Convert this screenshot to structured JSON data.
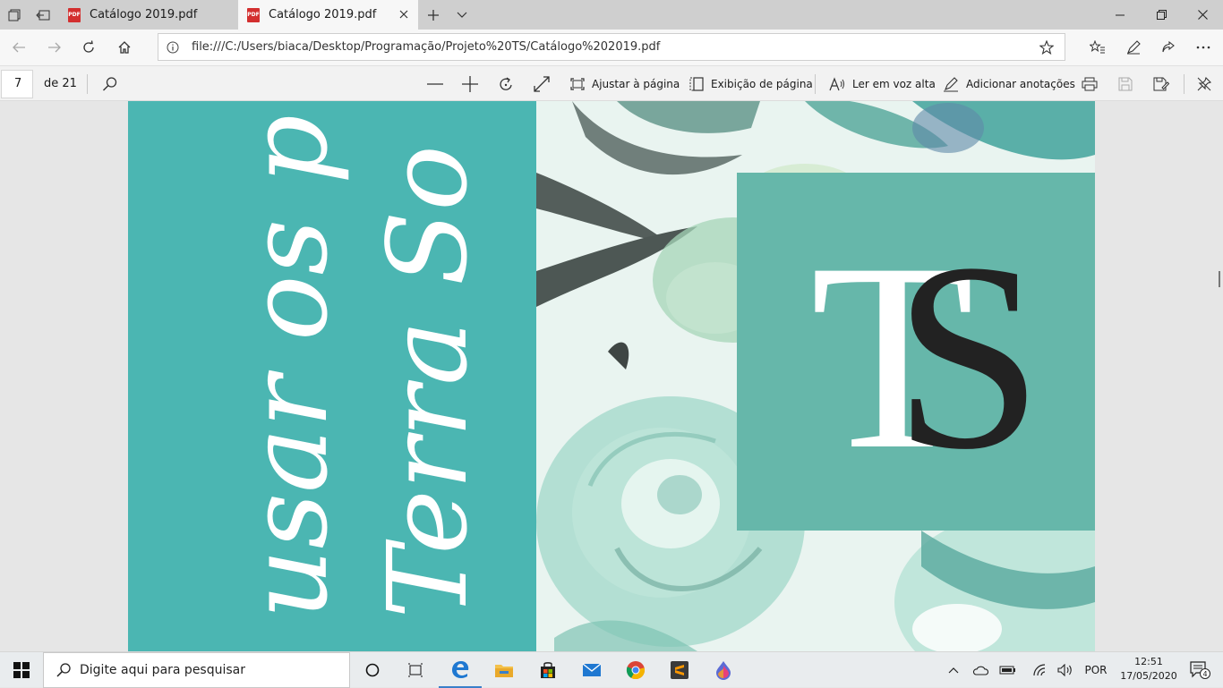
{
  "tabs": [
    {
      "label": "Catálogo 2019.pdf",
      "active": false
    },
    {
      "label": "Catálogo 2019.pdf",
      "active": true
    }
  ],
  "address": {
    "url": "file:///C:/Users/biaca/Desktop/Programação/Projeto%20TS/Catálogo%202019.pdf"
  },
  "pdf_toolbar": {
    "page_number": "7",
    "page_total": "de 21",
    "fit_page_label": "Ajustar à página",
    "page_view_label": "Exibição de página",
    "read_aloud_label": "Ler em voz alta",
    "annotate_label": "Adicionar anotações"
  },
  "page": {
    "script_line_1": "e usar os p",
    "script_line_2": "a Terra So",
    "logo_t": "T",
    "logo_s": "S",
    "colors": {
      "teal_panel": "#4bb6b2",
      "logo_box": "#66b7aa",
      "logo_s": "#222222"
    }
  },
  "taskbar": {
    "search_placeholder": "Digite aqui para pesquisar",
    "language": "POR",
    "time": "12:51",
    "date": "17/05/2020",
    "notification_count": "4"
  }
}
